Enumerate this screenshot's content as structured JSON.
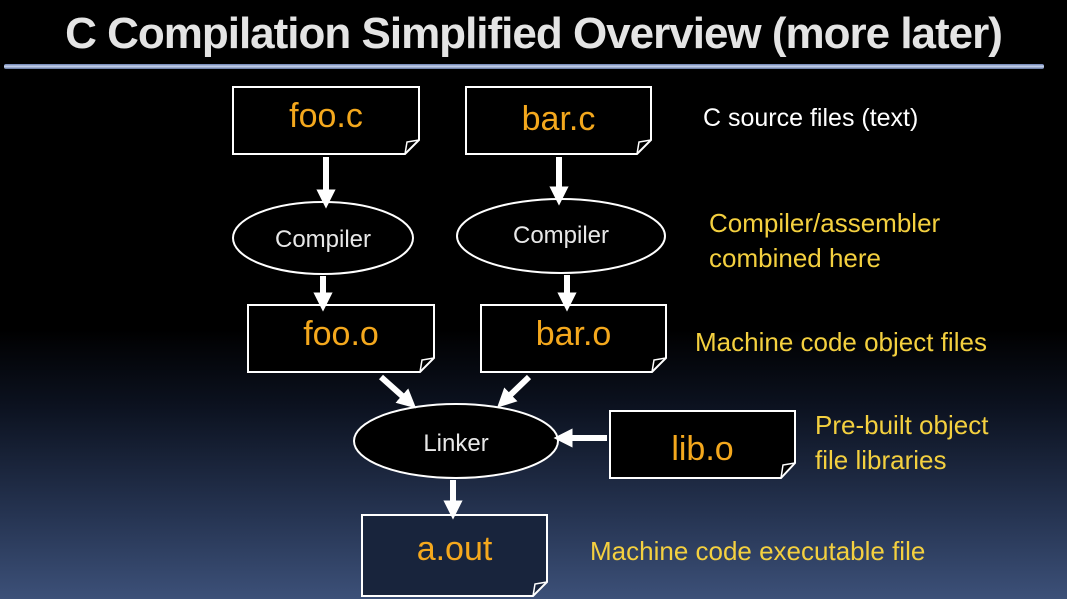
{
  "title": "C Compilation Simplified Overview (more later)",
  "files": {
    "foo_c": "foo.c",
    "bar_c": "bar.c",
    "foo_o": "foo.o",
    "bar_o": "bar.o",
    "lib_o": "lib.o",
    "a_out": "a.out"
  },
  "tools": {
    "compiler_left": "Compiler",
    "compiler_right": "Compiler",
    "linker": "Linker"
  },
  "notes": {
    "source_files": "C source files (text)",
    "compiler_line1": "Compiler/assembler",
    "compiler_line2": "combined here",
    "object_files": "Machine code object files",
    "prebuilt_line1": "Pre-built object",
    "prebuilt_line2": "file libraries",
    "executable": "Machine code executable file"
  },
  "colors": {
    "file_label": "#f4a81d",
    "note_white": "#ffffff",
    "note_yellow": "#f4d03f",
    "tool_label": "#e8e8e8",
    "stroke": "#ffffff"
  }
}
